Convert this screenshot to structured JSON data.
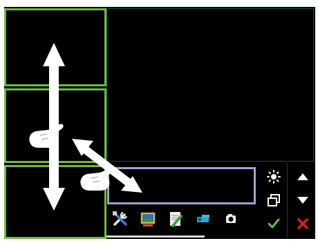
{
  "icons": {
    "tools": [
      "wrench-screwdriver-icon",
      "image-gallery-icon",
      "notes-icon",
      "projector-icon",
      "camera-icon"
    ],
    "side": [
      "brightness-icon",
      "scroll-up-icon",
      "window-restore-icon",
      "scroll-down-icon",
      "confirm-check-icon",
      "close-icon"
    ]
  },
  "colors": {
    "panel_border_green": "#6dbb3f",
    "panel_border_purple": "#a99fd1",
    "main_view_border": "#0d4f5a",
    "confirm_green": "#6dbb3f",
    "close_red": "#d9231f",
    "gesture_arrows": "#ffffff"
  }
}
